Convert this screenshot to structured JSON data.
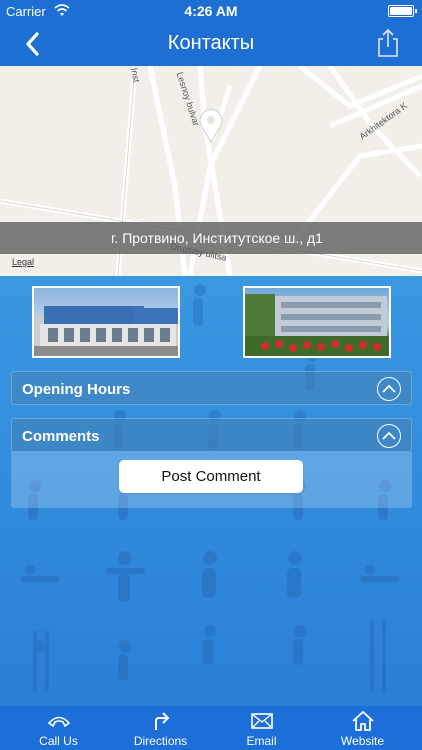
{
  "status_bar": {
    "carrier": "Carrier",
    "time": "4:26 AM"
  },
  "nav": {
    "title": "Контакты",
    "back_icon": "chevron-left-icon",
    "share_icon": "share-icon"
  },
  "map": {
    "address": "г. Протвино, Институтское ш., д1",
    "legal": "Legal",
    "streets": [
      "Inst",
      "Lesnoy bulvar",
      "Arkhitektora K",
      "Druzhby ulitsa"
    ]
  },
  "sections": {
    "opening_hours": "Opening Hours",
    "comments": "Comments"
  },
  "comments": {
    "post_label": "Post Comment"
  },
  "tabs": [
    {
      "label": "Call Us",
      "icon": "phone-icon"
    },
    {
      "label": "Directions",
      "icon": "directions-icon"
    },
    {
      "label": "Email",
      "icon": "mail-icon"
    },
    {
      "label": "Website",
      "icon": "home-icon"
    }
  ],
  "colors": {
    "nav": "#1e6fd4",
    "tab_bar": "#1c6ed8",
    "background": "#2a86d8"
  }
}
